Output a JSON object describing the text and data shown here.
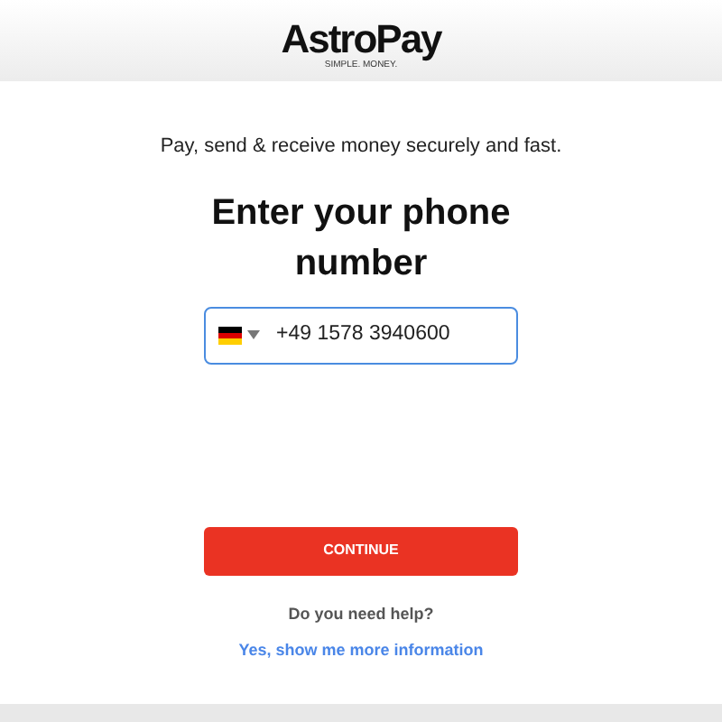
{
  "header": {
    "logo": "AstroPay",
    "tagline": "SIMPLE. MONEY."
  },
  "subtitle": "Pay, send & receive money securely and fast.",
  "title": "Enter your phone number",
  "phone_field": {
    "value": "+49 1578 3940600",
    "focused": true
  },
  "continue_button": "CONTINUE",
  "help": {
    "question": "Do you need help?",
    "link": "Yes, show me more information"
  }
}
